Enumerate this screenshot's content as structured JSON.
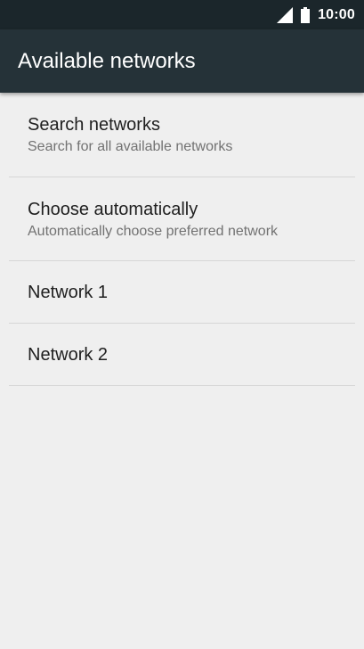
{
  "status_bar": {
    "time": "10:00",
    "icons": [
      "signal-icon",
      "battery-icon"
    ]
  },
  "app_bar": {
    "title": "Available networks"
  },
  "list": {
    "items": [
      {
        "title": "Search networks",
        "subtitle": "Search for all available networks"
      },
      {
        "title": "Choose automatically",
        "subtitle": "Automatically choose preferred network"
      },
      {
        "title": "Network 1"
      },
      {
        "title": "Network 2"
      }
    ]
  },
  "colors": {
    "status_bar": "#1b262b",
    "app_bar": "#253238",
    "background": "#efefef",
    "divider": "#d6d6d6",
    "primary_text": "#202020",
    "secondary_text": "#727272"
  }
}
